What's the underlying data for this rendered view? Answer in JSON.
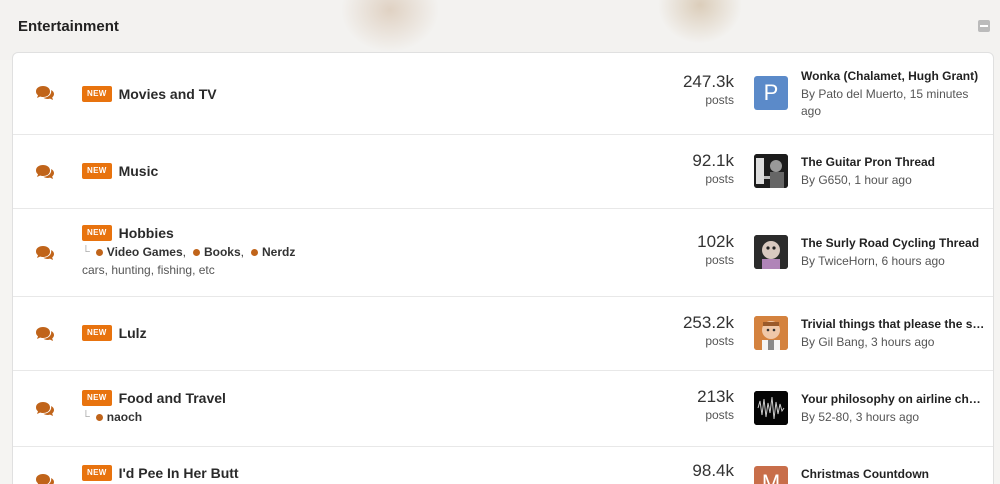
{
  "category": {
    "title": "Entertainment"
  },
  "new_badge": "NEW",
  "posts_label": "posts",
  "accent_color": "#e8730e",
  "forums": [
    {
      "title": "Movies and TV",
      "posts": "247.3k",
      "last_post": {
        "title": "Wonka (Chalamet, Hugh Grant)",
        "by": "By Pato del Muerto, 15 minutes ago",
        "avatar": "letter-avatar-P",
        "avatar_letter": "P"
      }
    },
    {
      "title": "Music",
      "posts": "92.1k",
      "last_post": {
        "title": "The Guitar Pron Thread",
        "by": "By G650, 1 hour ago",
        "avatar": "photo-avatar"
      }
    },
    {
      "title": "Hobbies",
      "subforums": [
        "Video Games",
        "Books",
        "Nerdz"
      ],
      "description": "cars, hunting, fishing, etc",
      "posts": "102k",
      "last_post": {
        "title": "The Surly Road Cycling Thread",
        "by": "By TwiceHorn, 6 hours ago",
        "avatar": "photo-avatar"
      }
    },
    {
      "title": "Lulz",
      "posts": "253.2k",
      "last_post": {
        "title": "Trivial things that please the soul",
        "by": "By Gil Bang, 3 hours ago",
        "avatar": "cartoon-avatar"
      }
    },
    {
      "title": "Food and Travel",
      "subforums": [
        "naoch"
      ],
      "posts": "213k",
      "last_post": {
        "title": "Your philosophy on airline check-in",
        "by": "By 52-80, 3 hours ago",
        "avatar": "waveform-avatar"
      }
    },
    {
      "title": "I'd Pee In Her Butt",
      "posts": "98.4k",
      "last_post": {
        "title": "Christmas Countdown",
        "by": "",
        "avatar": "letter-avatar-M",
        "avatar_letter": "M"
      }
    }
  ]
}
